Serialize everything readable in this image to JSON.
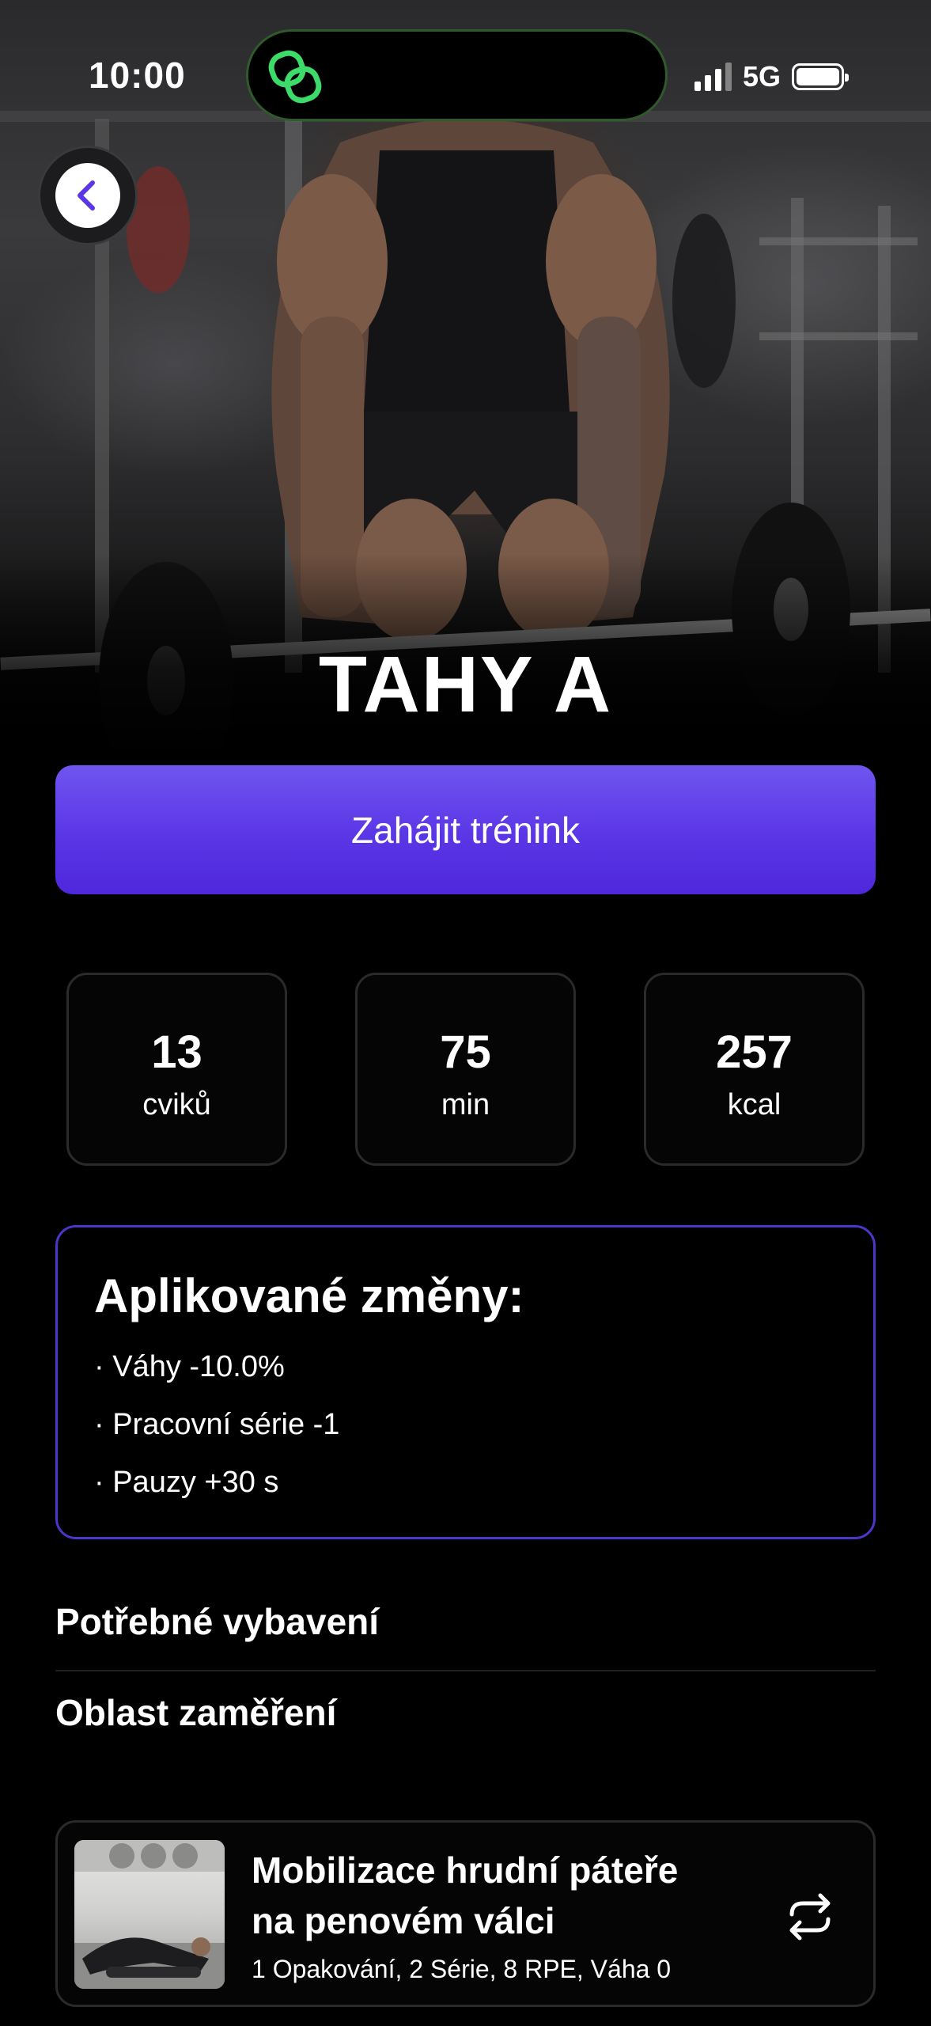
{
  "status_bar": {
    "time": "10:00",
    "network": "5G"
  },
  "hero": {
    "title": "TAHY A"
  },
  "start_button": {
    "label": "Zahájit trénink"
  },
  "stats": [
    {
      "value": "13",
      "unit": "cviků"
    },
    {
      "value": "75",
      "unit": "min"
    },
    {
      "value": "257",
      "unit": "kcal"
    }
  ],
  "changes": {
    "title": "Aplikované změny:",
    "items": [
      "· Váhy -10.0%",
      "· Pracovní série -1",
      "· Pauzy +30 s"
    ]
  },
  "sections": {
    "equipment": "Potřebné vybavení",
    "focus_area": "Oblast zaměření"
  },
  "exercise": {
    "name_line1": "Mobilizace hrudní páteře",
    "name_line2": "na penovém válci",
    "meta": "1 Opakování, 2 Série, 8 RPE, Váha 0"
  },
  "colors": {
    "accent": "#5a36e6",
    "accent_border": "#4a37c9",
    "island_green": "#3ddc6a"
  },
  "icons": {
    "back": "chevron-left-icon",
    "swap": "swap-icon",
    "island": "link-icon"
  }
}
